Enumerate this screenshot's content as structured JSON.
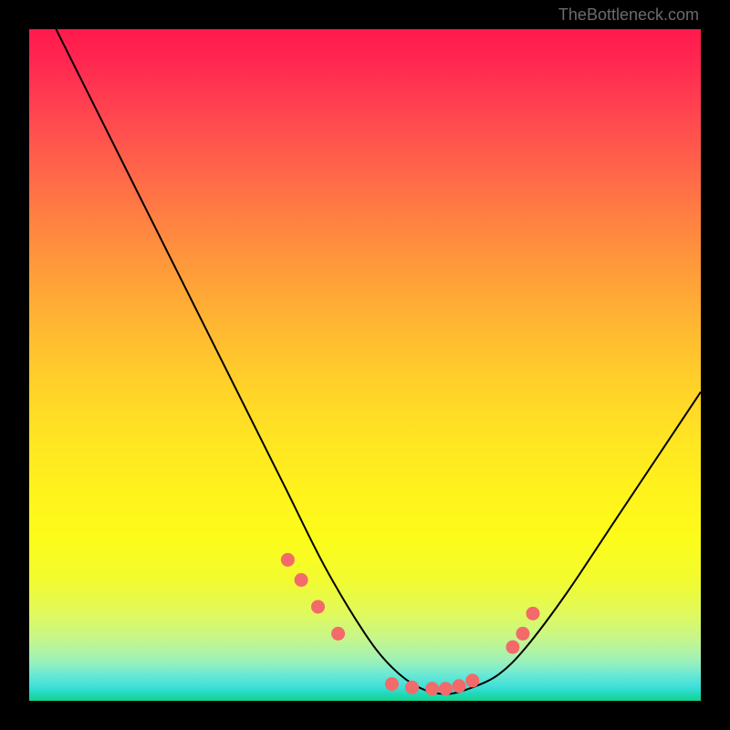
{
  "watermark": "TheBottleneck.com",
  "chart_data": {
    "type": "line",
    "title": "",
    "xlabel": "",
    "ylabel": "",
    "xlim": [
      0,
      100
    ],
    "ylim": [
      0,
      100
    ],
    "grid": false,
    "legend": false,
    "series": [
      {
        "name": "bottleneck-curve",
        "x": [
          4,
          10,
          20,
          30,
          38,
          44,
          50,
          54,
          58,
          62,
          66,
          70,
          74,
          80,
          88,
          100
        ],
        "y": [
          100,
          88,
          68,
          48,
          32,
          20,
          10,
          5,
          2,
          1,
          2,
          4,
          8,
          16,
          28,
          46
        ]
      }
    ],
    "markers": {
      "name": "highlighted-points",
      "color": "#f26a6a",
      "x": [
        38.5,
        40.5,
        43,
        46,
        54,
        57,
        60,
        62,
        64,
        66,
        72,
        73.5,
        75
      ],
      "y": [
        21,
        18,
        14,
        10,
        2.5,
        2,
        1.8,
        1.8,
        2.2,
        3,
        8,
        10,
        13
      ]
    },
    "background": {
      "type": "vertical-gradient",
      "stops": [
        {
          "pos": 0.0,
          "color": "#ff1a4d"
        },
        {
          "pos": 0.5,
          "color": "#ffd428"
        },
        {
          "pos": 0.85,
          "color": "#f2fb30"
        },
        {
          "pos": 1.0,
          "color": "#14d489"
        }
      ]
    }
  }
}
